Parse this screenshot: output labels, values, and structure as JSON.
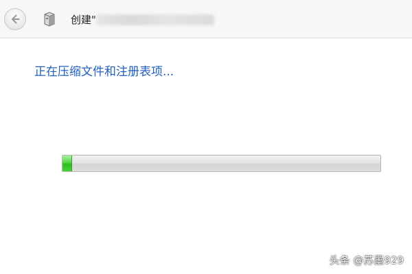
{
  "header": {
    "title_prefix": "创建\"",
    "back_icon": "back-arrow-icon",
    "app_icon": "package-icon"
  },
  "main": {
    "status_text": "正在压缩文件和注册表项...",
    "progress_fraction": 0.03
  },
  "watermark": {
    "text": "头条 @苏墨929"
  },
  "colors": {
    "status_text": "#1f5fbf",
    "progress_fill": "#3cc832",
    "titlebar_bg": "#f7f7f7"
  }
}
